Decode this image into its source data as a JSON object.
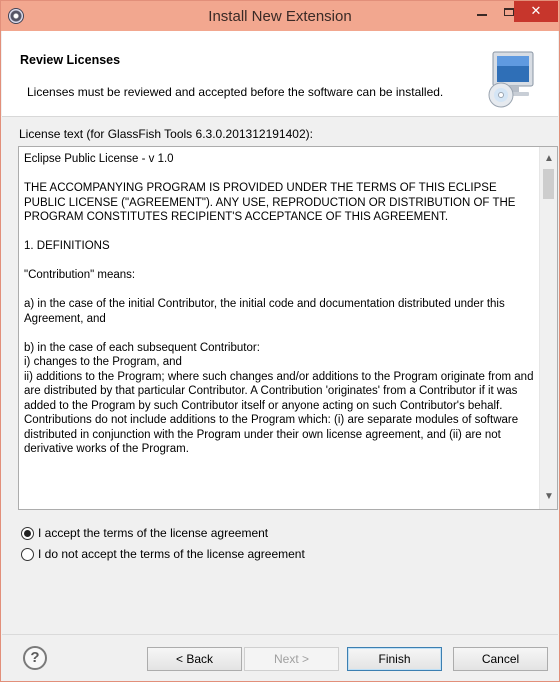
{
  "window": {
    "title": "Install New Extension",
    "minimize_glyph": "",
    "maximize_glyph": "",
    "close_glyph": "✕"
  },
  "header": {
    "title": "Review Licenses",
    "description": "Licenses must be reviewed and accepted before the software can be installed.",
    "image_icon": "computer-cd-icon"
  },
  "license": {
    "label": "License text (for GlassFish Tools 6.3.0.201312191402):",
    "text": "Eclipse Public License - v 1.0\n\nTHE ACCOMPANYING PROGRAM IS PROVIDED UNDER THE TERMS OF THIS ECLIPSE PUBLIC LICENSE (\"AGREEMENT\"). ANY USE, REPRODUCTION OR DISTRIBUTION OF THE PROGRAM CONSTITUTES RECIPIENT'S ACCEPTANCE OF THIS AGREEMENT.\n\n1. DEFINITIONS\n\n\"Contribution\" means:\n\na) in the case of the initial Contributor, the initial code and documentation distributed under this Agreement, and\n\nb) in the case of each subsequent Contributor:\ni) changes to the Program, and\nii) additions to the Program; where such changes and/or additions to the Program originate from and are distributed by that particular Contributor. A Contribution 'originates' from a Contributor if it was added to the Program by such Contributor itself or anyone acting on such Contributor's behalf. Contributions do not include additions to the Program which: (i) are separate modules of software distributed in conjunction with the Program under their own license agreement, and (ii) are not derivative works of the Program."
  },
  "options": {
    "accept_label": "I accept the terms of the license agreement",
    "decline_label": "I do not accept the terms of the license agreement",
    "selected": "accept"
  },
  "buttons": {
    "help": "?",
    "back": "< Back",
    "next": "Next >",
    "finish": "Finish",
    "cancel": "Cancel"
  },
  "colors": {
    "titlebar": "#f2a78f",
    "close_button": "#c7362c"
  }
}
